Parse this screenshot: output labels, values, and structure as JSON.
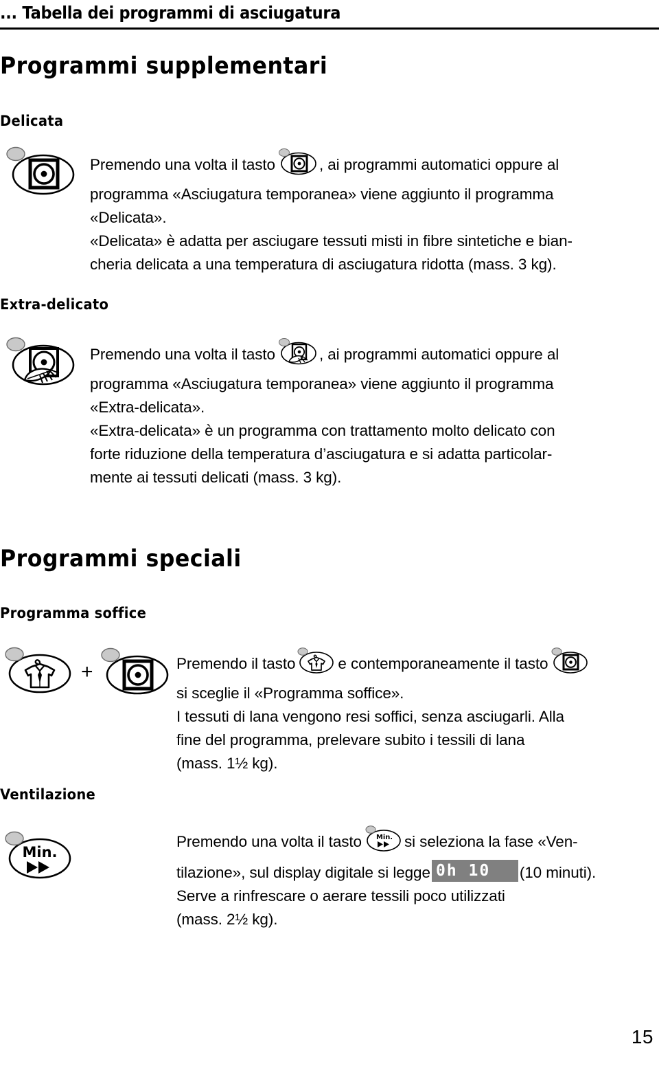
{
  "header": {
    "title": "... Tabella dei programmi di asciugatura"
  },
  "sections": [
    {
      "id": "programmi-supplementari",
      "heading": "Programmi supplementari",
      "subsections": [
        {
          "id": "delicata",
          "heading": "Delicata",
          "icon": "dryer-drum-button-icon",
          "lines": [
            "Premendo una volta il tasto      , ai programmi automatici oppure al",
            "programma «Asciugatura temporanea» viene aggiunto il programma",
            "«Delicata».",
            "«Delicata» è adatta per asciugare tessuti misti in fibre sintetiche e bian-",
            "cheria delicata a una temperatura di asciugatura ridotta (mass. 3 kg)."
          ]
        },
        {
          "id": "extra-delicato",
          "heading": "Extra-delicato",
          "icon": "dryer-drum-feather-button-icon",
          "lines": [
            "Premendo una volta il tasto      , ai programmi automatici oppure al",
            "programma «Asciugatura temporanea» viene aggiunto il programma",
            "«Extra-delicata».",
            "«Extra-delicata» è un programma con trattamento molto delicato con",
            "forte riduzione della temperatura d’asciugatura e si adatta particolar-",
            "mente ai tessuti delicati (mass. 3 kg)."
          ]
        }
      ]
    },
    {
      "id": "programmi-speciali",
      "heading": "Programmi speciali",
      "subsections": [
        {
          "id": "programma-soffice",
          "heading": "Programma soffice",
          "icon": "shirt-hanger-button-icon",
          "icon2": "dryer-drum-button-icon",
          "plus": "+",
          "lines": [
            "Premendo il tasto       e contemporaneamente il tasto      ",
            "si sceglie il «Programma soffice».",
            "I tessuti di lana vengono resi soffici, senza asciugarli. Alla",
            "fine del programma, prelevare subito i tessili di lana",
            "(mass. 1½ kg)."
          ]
        },
        {
          "id": "ventilazione",
          "heading": "Ventilazione",
          "icon": "min-fastforward-button-icon",
          "icon_label": "Min.",
          "lines": [
            "Premendo una volta il tasto       si seleziona la fase «Ven-",
            "tilazione», sul display digitale si legge         (10 minuti).",
            "Serve a rinfrescare o aerare tessili poco utilizzati",
            "(mass. 2½ kg)."
          ],
          "display_value": "0h 10"
        }
      ]
    }
  ],
  "footer": {
    "page_number": "15"
  },
  "colors": {
    "ink": "#000000",
    "paper": "#ffffff",
    "led_gray": "#c9c9c9",
    "display_gray": "#808080"
  }
}
